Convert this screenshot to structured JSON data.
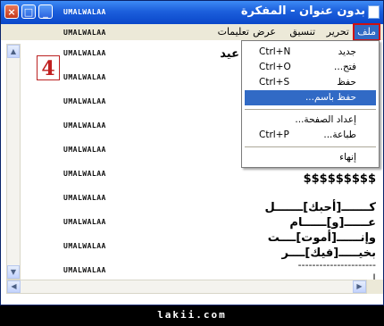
{
  "window": {
    "title": "بدون عنوان - المفكرة",
    "buttons": {
      "minimize": "_",
      "maximize": "□",
      "close": "×"
    }
  },
  "watermark": "UMALWALAA",
  "menubar": [
    {
      "label": "ملف"
    },
    {
      "label": "تحرير"
    },
    {
      "label": "تنسيق"
    },
    {
      "label": "عرض"
    },
    {
      "label": "تعليمات"
    }
  ],
  "step_badge": "4",
  "file_menu": {
    "items": [
      {
        "label": "جديد",
        "shortcut": "Ctrl+N"
      },
      {
        "label": "فتح...",
        "shortcut": "Ctrl+O"
      },
      {
        "label": "حفظ",
        "shortcut": "Ctrl+S"
      },
      {
        "label": "حفظ باسم...",
        "shortcut": ""
      },
      {
        "label": "إعداد الصفحة...",
        "shortcut": ""
      },
      {
        "label": "طباعة...",
        "shortcut": "Ctrl+P"
      },
      {
        "label": "إنهاء",
        "shortcut": ""
      }
    ],
    "highlighted_index": 3
  },
  "editor": {
    "first_line_fragment": "عيد",
    "lines": [
      "$$$$$$$$$",
      "كـــــــ[أحبك]ـــــــل",
      "عــــــ[و]ــــــام",
      "وإنــــــ[أموت]ــــت",
      "بخيـــــ[فيك]ــــر",
      "----------------------",
      "|"
    ]
  },
  "footer": "lakii.com",
  "colors": {
    "title_bar": "#1c5fdc",
    "menu_highlight": "#316ac5",
    "badge_red": "#c02020"
  }
}
